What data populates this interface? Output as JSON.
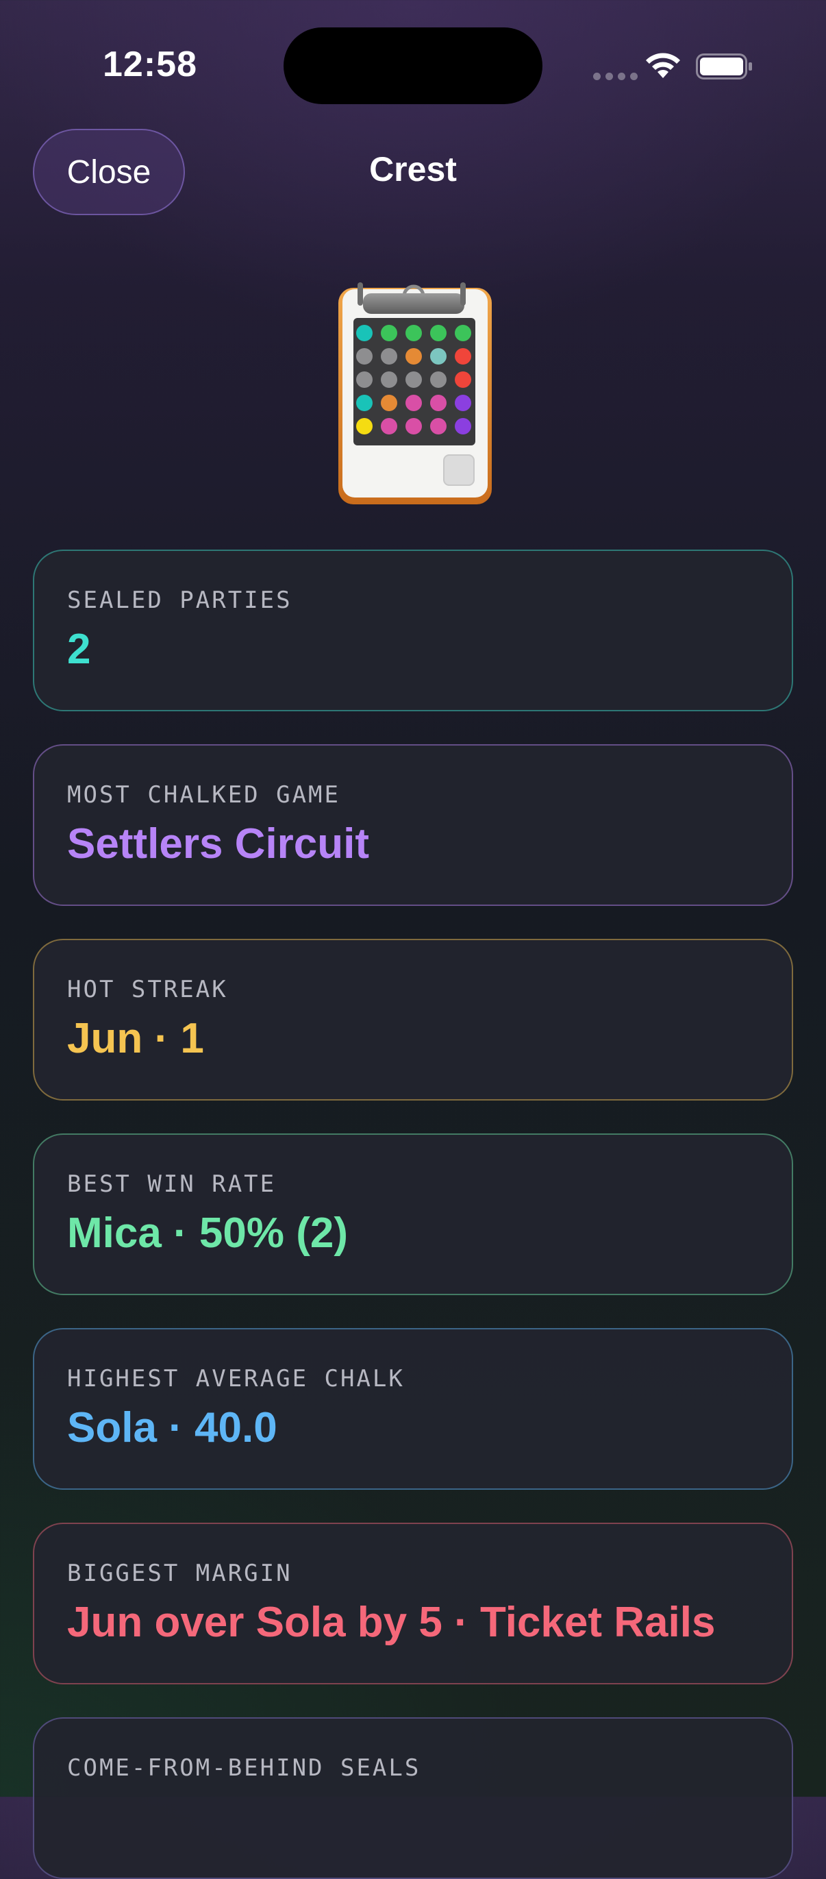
{
  "status_bar": {
    "time": "12:58"
  },
  "nav": {
    "close_label": "Close",
    "title": "Crest"
  },
  "hero_icon": "clipboard-bead-grid-icon",
  "cards": [
    {
      "label": "SEALED PARTIES",
      "value": "2",
      "accent": "#3ee0cf"
    },
    {
      "label": "MOST CHALKED GAME",
      "value": "Settlers Circuit",
      "accent": "#b784f7"
    },
    {
      "label": "HOT STREAK",
      "value": "Jun · 1",
      "accent": "#f5c451"
    },
    {
      "label": "BEST WIN RATE",
      "value": "Mica · 50% (2)",
      "accent": "#6ee7a8"
    },
    {
      "label": "HIGHEST AVERAGE CHALK",
      "value": "Sola · 40.0",
      "accent": "#5eb6f6"
    },
    {
      "label": "BIGGEST MARGIN",
      "value": "Jun over Sola by 5 · Ticket Rails",
      "accent": "#f5687a"
    },
    {
      "label": "COME-FROM-BEHIND SEALS",
      "value": "",
      "accent": "#8a7bd6"
    }
  ]
}
